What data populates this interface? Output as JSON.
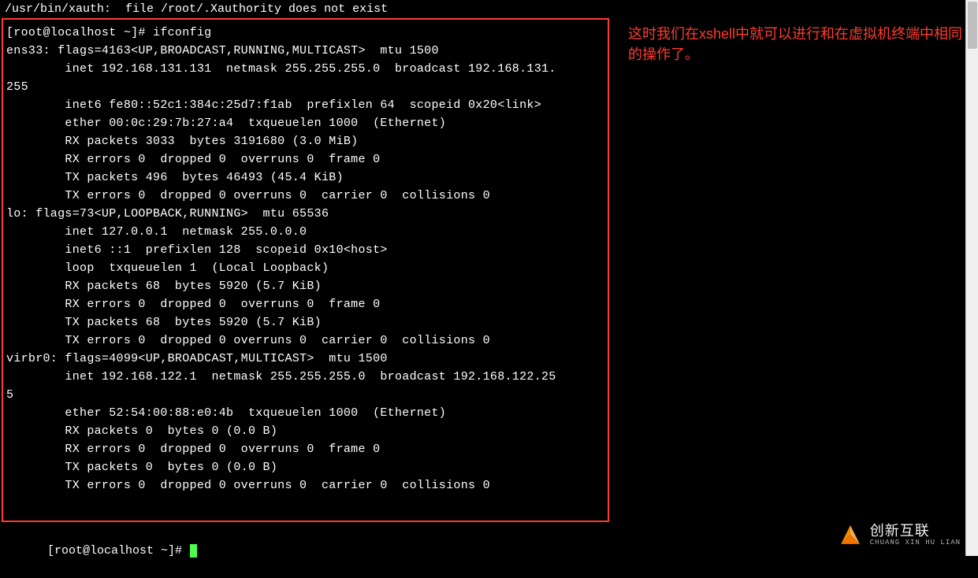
{
  "header_line": "/usr/bin/xauth:  file /root/.Xauthority does not exist",
  "terminal_lines": [
    "[root@localhost ~]# ifconfig",
    "ens33: flags=4163<UP,BROADCAST,RUNNING,MULTICAST>  mtu 1500",
    "        inet 192.168.131.131  netmask 255.255.255.0  broadcast 192.168.131.",
    "255",
    "        inet6 fe80::52c1:384c:25d7:f1ab  prefixlen 64  scopeid 0x20<link>",
    "        ether 00:0c:29:7b:27:a4  txqueuelen 1000  (Ethernet)",
    "        RX packets 3033  bytes 3191680 (3.0 MiB)",
    "        RX errors 0  dropped 0  overruns 0  frame 0",
    "        TX packets 496  bytes 46493 (45.4 KiB)",
    "        TX errors 0  dropped 0 overruns 0  carrier 0  collisions 0",
    "",
    "lo: flags=73<UP,LOOPBACK,RUNNING>  mtu 65536",
    "        inet 127.0.0.1  netmask 255.0.0.0",
    "        inet6 ::1  prefixlen 128  scopeid 0x10<host>",
    "        loop  txqueuelen 1  (Local Loopback)",
    "        RX packets 68  bytes 5920 (5.7 KiB)",
    "        RX errors 0  dropped 0  overruns 0  frame 0",
    "        TX packets 68  bytes 5920 (5.7 KiB)",
    "        TX errors 0  dropped 0 overruns 0  carrier 0  collisions 0",
    "",
    "virbr0: flags=4099<UP,BROADCAST,MULTICAST>  mtu 1500",
    "        inet 192.168.122.1  netmask 255.255.255.0  broadcast 192.168.122.25",
    "5",
    "        ether 52:54:00:88:e0:4b  txqueuelen 1000  (Ethernet)",
    "        RX packets 0  bytes 0 (0.0 B)",
    "        RX errors 0  dropped 0  overruns 0  frame 0",
    "        TX packets 0  bytes 0 (0.0 B)",
    "        TX errors 0  dropped 0 overruns 0  carrier 0  collisions 0"
  ],
  "bottom_prompt": "[root@localhost ~]# ",
  "annotation": "这时我们在xshell中就可以进行和在虚拟机终端中相同的操作了。",
  "watermark": {
    "main": "创新互联",
    "sub": "CHUANG XIN HU LIAN"
  }
}
